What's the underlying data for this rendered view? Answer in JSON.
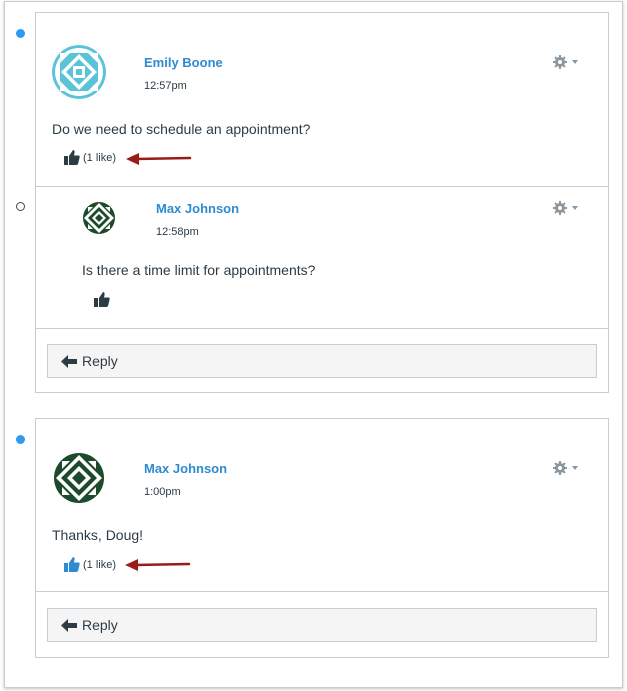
{
  "colors": {
    "unread_dot": "#2d9bf0",
    "author_link": "#2d8bd1",
    "annotation_arrow": "#9b1b1b",
    "like_active": "#2d8bd1",
    "like_inactive": "#2d3b45"
  },
  "thread1": {
    "entry": {
      "author": "Emily Boone",
      "time": "12:57pm",
      "message": "Do we need to schedule an appointment?",
      "likes": "(1 like)",
      "liked": false
    },
    "reply": {
      "author": "Max Johnson",
      "time": "12:58pm",
      "message": "Is there a time limit for appointments?"
    },
    "reply_button": "Reply"
  },
  "thread2": {
    "entry": {
      "author": "Max Johnson",
      "time": "1:00pm",
      "message": "Thanks, Doug!",
      "likes": "(1 like)",
      "liked": true
    },
    "reply_button": "Reply"
  },
  "icons": [
    "gear-icon",
    "caret-down-icon",
    "thumbs-up-icon",
    "reply-arrow-icon",
    "annotation-arrow-icon"
  ]
}
